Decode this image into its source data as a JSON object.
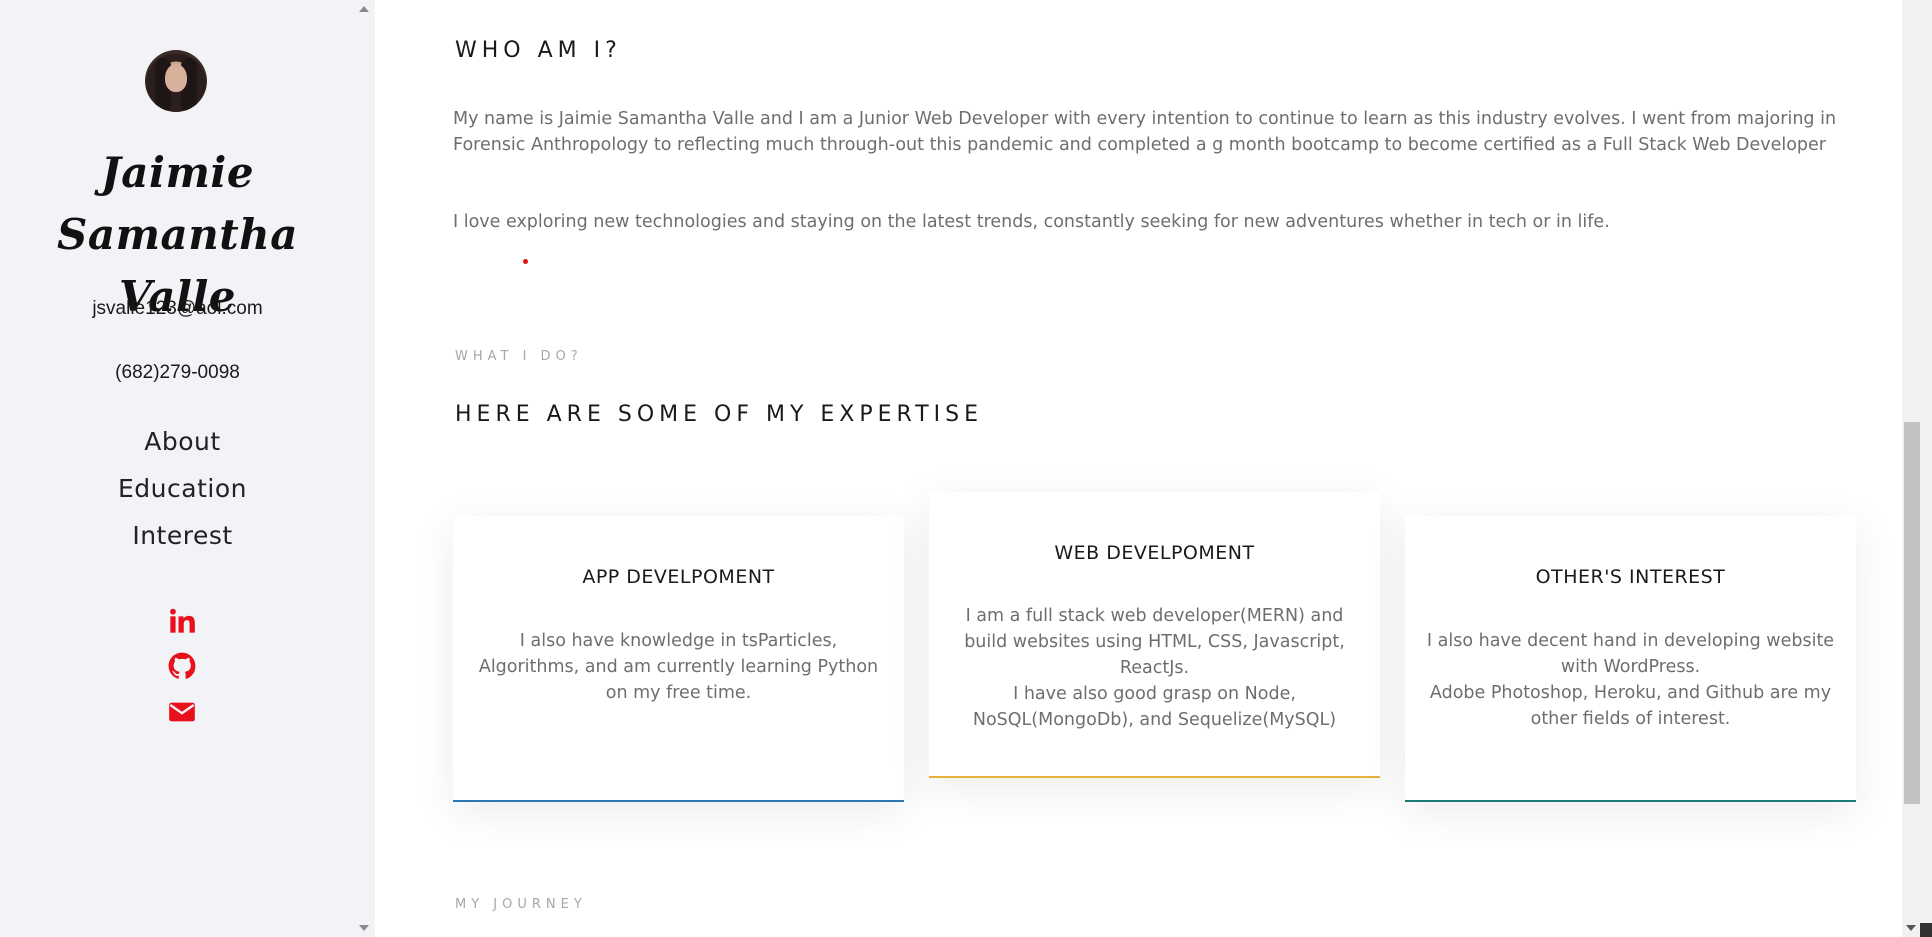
{
  "sidebar": {
    "avatar_alt": "Profile photo",
    "name": "Jaimie Samantha Valle",
    "email": "jsvalle123@aol.com",
    "phone": "(682)279-0098",
    "nav": [
      {
        "label": "About"
      },
      {
        "label": "Education"
      },
      {
        "label": "Interest"
      }
    ],
    "social": [
      {
        "icon": "linkedin-icon"
      },
      {
        "icon": "github-icon"
      },
      {
        "icon": "envelope-icon"
      }
    ],
    "accent_color": "#e8101a"
  },
  "about": {
    "heading": "WHO AM I?",
    "paragraph1": "My name is Jaimie Samantha Valle and I am a Junior Web Developer with every intention to continue to learn as this industry evolves. I went from majoring in Forensic Anthropology to reflecting much through-out this pandemic and completed a g month bootcamp to become certified as a Full Stack Web Developer",
    "paragraph2": "I love exploring new technologies and staying on the latest trends, constantly seeking for new adventures whether in tech or in life."
  },
  "expertise": {
    "eyebrow": "WHAT I DO?",
    "heading": "HERE ARE SOME OF MY EXPERTISE",
    "cards": [
      {
        "title": "APP DEVELPOMENT",
        "body": "I also have knowledge in tsParticles, Algorithms, and am currently learning Python on my free time.",
        "border_color": "#2a77b8"
      },
      {
        "title": "WEB DEVELPOMENT",
        "body": "I am a full stack web developer(MERN) and build websites using HTML, CSS, Javascript, ReactJs.\nI have also good grasp on Node, NoSQL(MongoDb), and Sequelize(MySQL)",
        "border_color": "#e5b33b"
      },
      {
        "title": "OTHER'S INTEREST",
        "body": "I also have decent hand in developing website with WordPress.\nAdobe Photoshop, Heroku, and Github are my other fields of interest.",
        "border_color": "#1e7a74"
      }
    ]
  },
  "journey": {
    "eyebrow": "MY JOURNEY"
  }
}
